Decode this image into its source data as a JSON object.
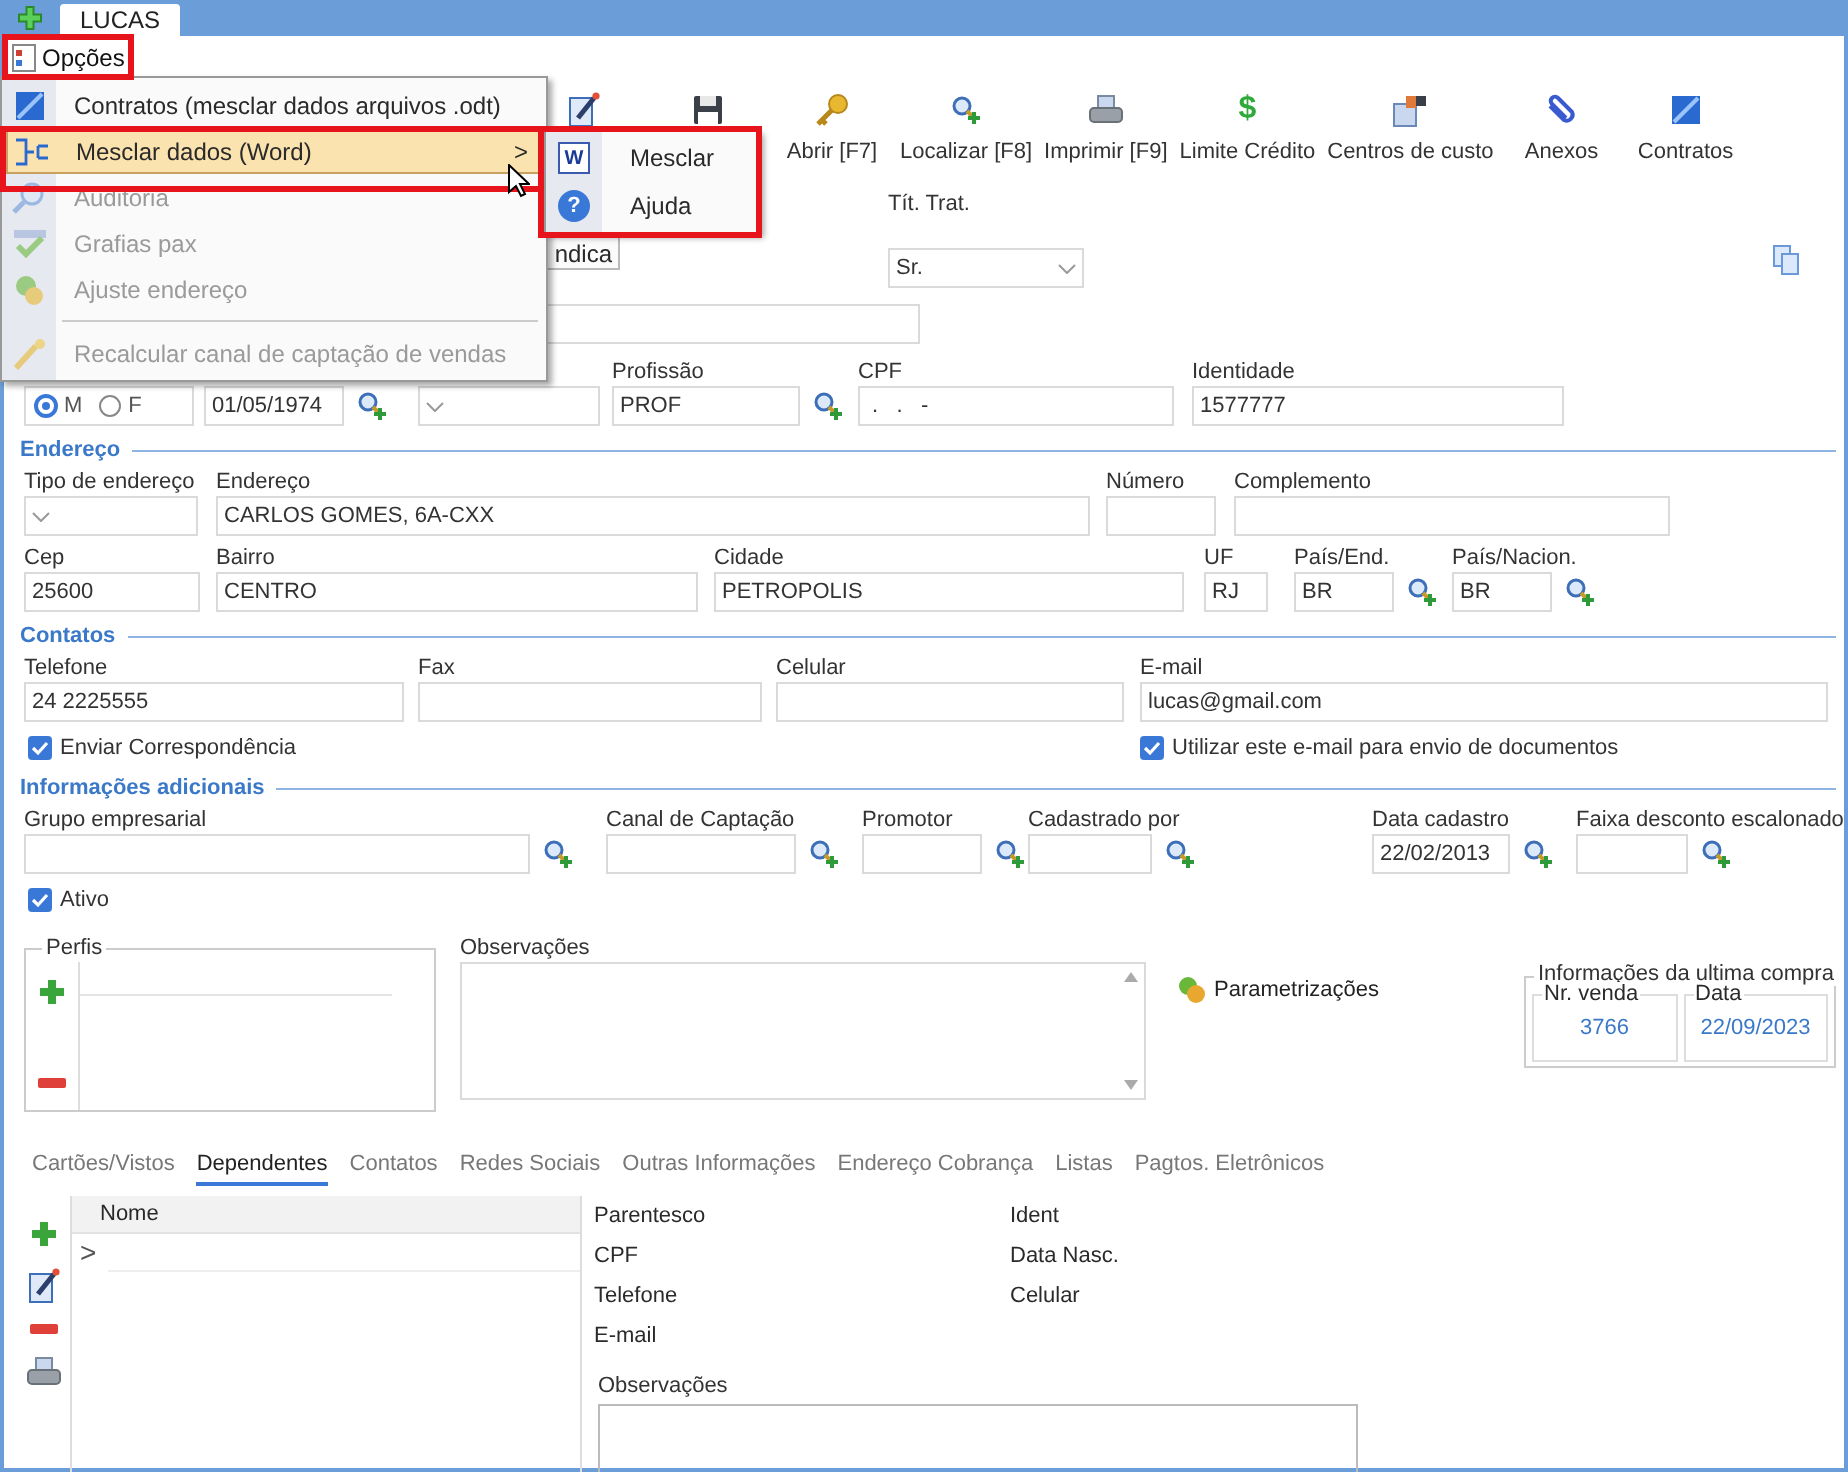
{
  "window": {
    "tab_title": "LUCAS"
  },
  "menu_bar": {
    "label": "Opções"
  },
  "options_menu": [
    {
      "kind": "contracts",
      "label": "Contratos (mesclar dados arquivos .odt)",
      "disabled": false,
      "selected": false
    },
    {
      "kind": "merge",
      "label": "Mesclar dados (Word)",
      "disabled": false,
      "selected": true,
      "arrow": ">"
    },
    {
      "kind": "audit",
      "label": "Auditoria",
      "disabled": true,
      "selected": false
    },
    {
      "kind": "spelling",
      "label": "Grafias pax",
      "disabled": true,
      "selected": false
    },
    {
      "kind": "address",
      "label": "Ajuste endereço",
      "disabled": true,
      "selected": false
    },
    {
      "kind": "separator"
    },
    {
      "kind": "recalc",
      "label": "Recalcular canal de captação de vendas",
      "disabled": true,
      "selected": false
    }
  ],
  "submenu": [
    {
      "label": "Mesclar",
      "glyph": "W"
    },
    {
      "label": "Ajuda",
      "glyph": "?"
    }
  ],
  "toolbar": [
    {
      "kind": "edit"
    },
    {
      "kind": "save"
    },
    {
      "kind": "open",
      "label": "Abrir [F7]"
    },
    {
      "kind": "find",
      "label": "Localizar [F8]"
    },
    {
      "kind": "print",
      "label": "Imprimir [F9]"
    },
    {
      "kind": "credit",
      "label": "Limite Crédito",
      "glyph": "$"
    },
    {
      "kind": "cost",
      "label": "Centros de custo"
    },
    {
      "kind": "attach",
      "label": "Anexos"
    },
    {
      "kind": "contracts",
      "label": "Contratos"
    }
  ],
  "partial_button": "ndica",
  "title_field": {
    "label": "Tít. Trat.",
    "value": "Sr."
  },
  "personal": {
    "sex": [
      {
        "label": "M",
        "selected": true
      },
      {
        "label": "F",
        "selected": false
      }
    ],
    "fields": [
      {
        "kind": "lookup",
        "value": "01/05/1974"
      },
      {
        "kind": "select"
      },
      {
        "label": "Profissão",
        "value": "PROF",
        "kind": "lookup"
      },
      {
        "label": "CPF",
        "value": " .   .   -",
        "kind": "text"
      },
      {
        "label": "Identidade",
        "value": "1577777",
        "kind": "text"
      }
    ]
  },
  "sections": [
    {
      "title": "Endereço",
      "rows": [
        {
          "kind": "fields",
          "fields": [
            {
              "label": "Tipo de endereço",
              "kind": "select"
            },
            {
              "label": "Endereço",
              "value": "CARLOS GOMES, 6A-CXX",
              "kind": "text"
            },
            {
              "label": "Número",
              "kind": "text"
            },
            {
              "label": "Complemento",
              "kind": "text"
            }
          ]
        },
        {
          "kind": "fields",
          "fields": [
            {
              "label": "Cep",
              "value": "25600",
              "kind": "text"
            },
            {
              "label": "Bairro",
              "value": "CENTRO",
              "kind": "text"
            },
            {
              "label": "Cidade",
              "value": "PETROPOLIS",
              "kind": "text"
            },
            {
              "label": "UF",
              "value": "RJ",
              "kind": "text"
            },
            {
              "label": "País/End.",
              "value": "BR",
              "kind": "lookup"
            },
            {
              "label": "País/Nacion.",
              "value": "BR",
              "kind": "lookup"
            }
          ]
        }
      ]
    },
    {
      "title": "Contatos",
      "rows": [
        {
          "kind": "fields",
          "fields": [
            {
              "label": "Telefone",
              "value": "24 2225555",
              "kind": "text"
            },
            {
              "label": "Fax",
              "kind": "text"
            },
            {
              "label": "Celular",
              "kind": "text"
            },
            {
              "label": "E-mail",
              "value": "lucas@gmail.com",
              "kind": "text"
            }
          ]
        },
        {
          "kind": "checks",
          "checks": [
            {
              "label": "Enviar Correspondência",
              "checked": true
            },
            {
              "label": "Utilizar este e-mail para envio de documentos",
              "checked": true
            }
          ]
        }
      ]
    },
    {
      "title": "Informações adicionais",
      "rows": [
        {
          "kind": "fields",
          "fields": [
            {
              "label": "Grupo empresarial",
              "kind": "lookup"
            },
            {
              "label": "Canal de Captação",
              "kind": "lookup"
            },
            {
              "label": "Promotor",
              "kind": "lookup"
            },
            {
              "label": "Cadastrado por",
              "kind": "lookup"
            },
            {
              "label": "Data cadastro",
              "value": "22/02/2013",
              "kind": "lookup"
            },
            {
              "label": "Faixa desconto escalonado",
              "kind": "lookup"
            }
          ]
        },
        {
          "kind": "checks",
          "checks": [
            {
              "label": "Ativo",
              "checked": true
            }
          ]
        }
      ]
    }
  ],
  "profiles": {
    "title": "Perfis"
  },
  "notes": {
    "label": "Observações"
  },
  "settings_link": "Parametrizações",
  "last_purchase": {
    "title": "Informações da ultima compra",
    "columns": [
      {
        "label": "Nr. venda",
        "value": "3766"
      },
      {
        "label": "Data",
        "value": "22/09/2023"
      }
    ]
  },
  "tabs": [
    {
      "label": "Cartões/Vistos",
      "selected": false
    },
    {
      "label": "Dependentes",
      "selected": true
    },
    {
      "label": "Contatos",
      "selected": false
    },
    {
      "label": "Redes Sociais",
      "selected": false
    },
    {
      "label": "Outras Informações",
      "selected": false
    },
    {
      "label": "Endereço Cobrança",
      "selected": false
    },
    {
      "label": "Listas",
      "selected": false
    },
    {
      "label": "Pagtos. Eletrônicos",
      "selected": false
    }
  ],
  "dependents": {
    "columns": [
      "Nome"
    ],
    "row_marker": ">",
    "labels_left": [
      "Parentesco",
      "CPF",
      "Telefone",
      "E-mail"
    ],
    "labels_right": [
      "Ident",
      "Data Nasc.",
      "Celular"
    ],
    "notes_label": "Observações"
  }
}
